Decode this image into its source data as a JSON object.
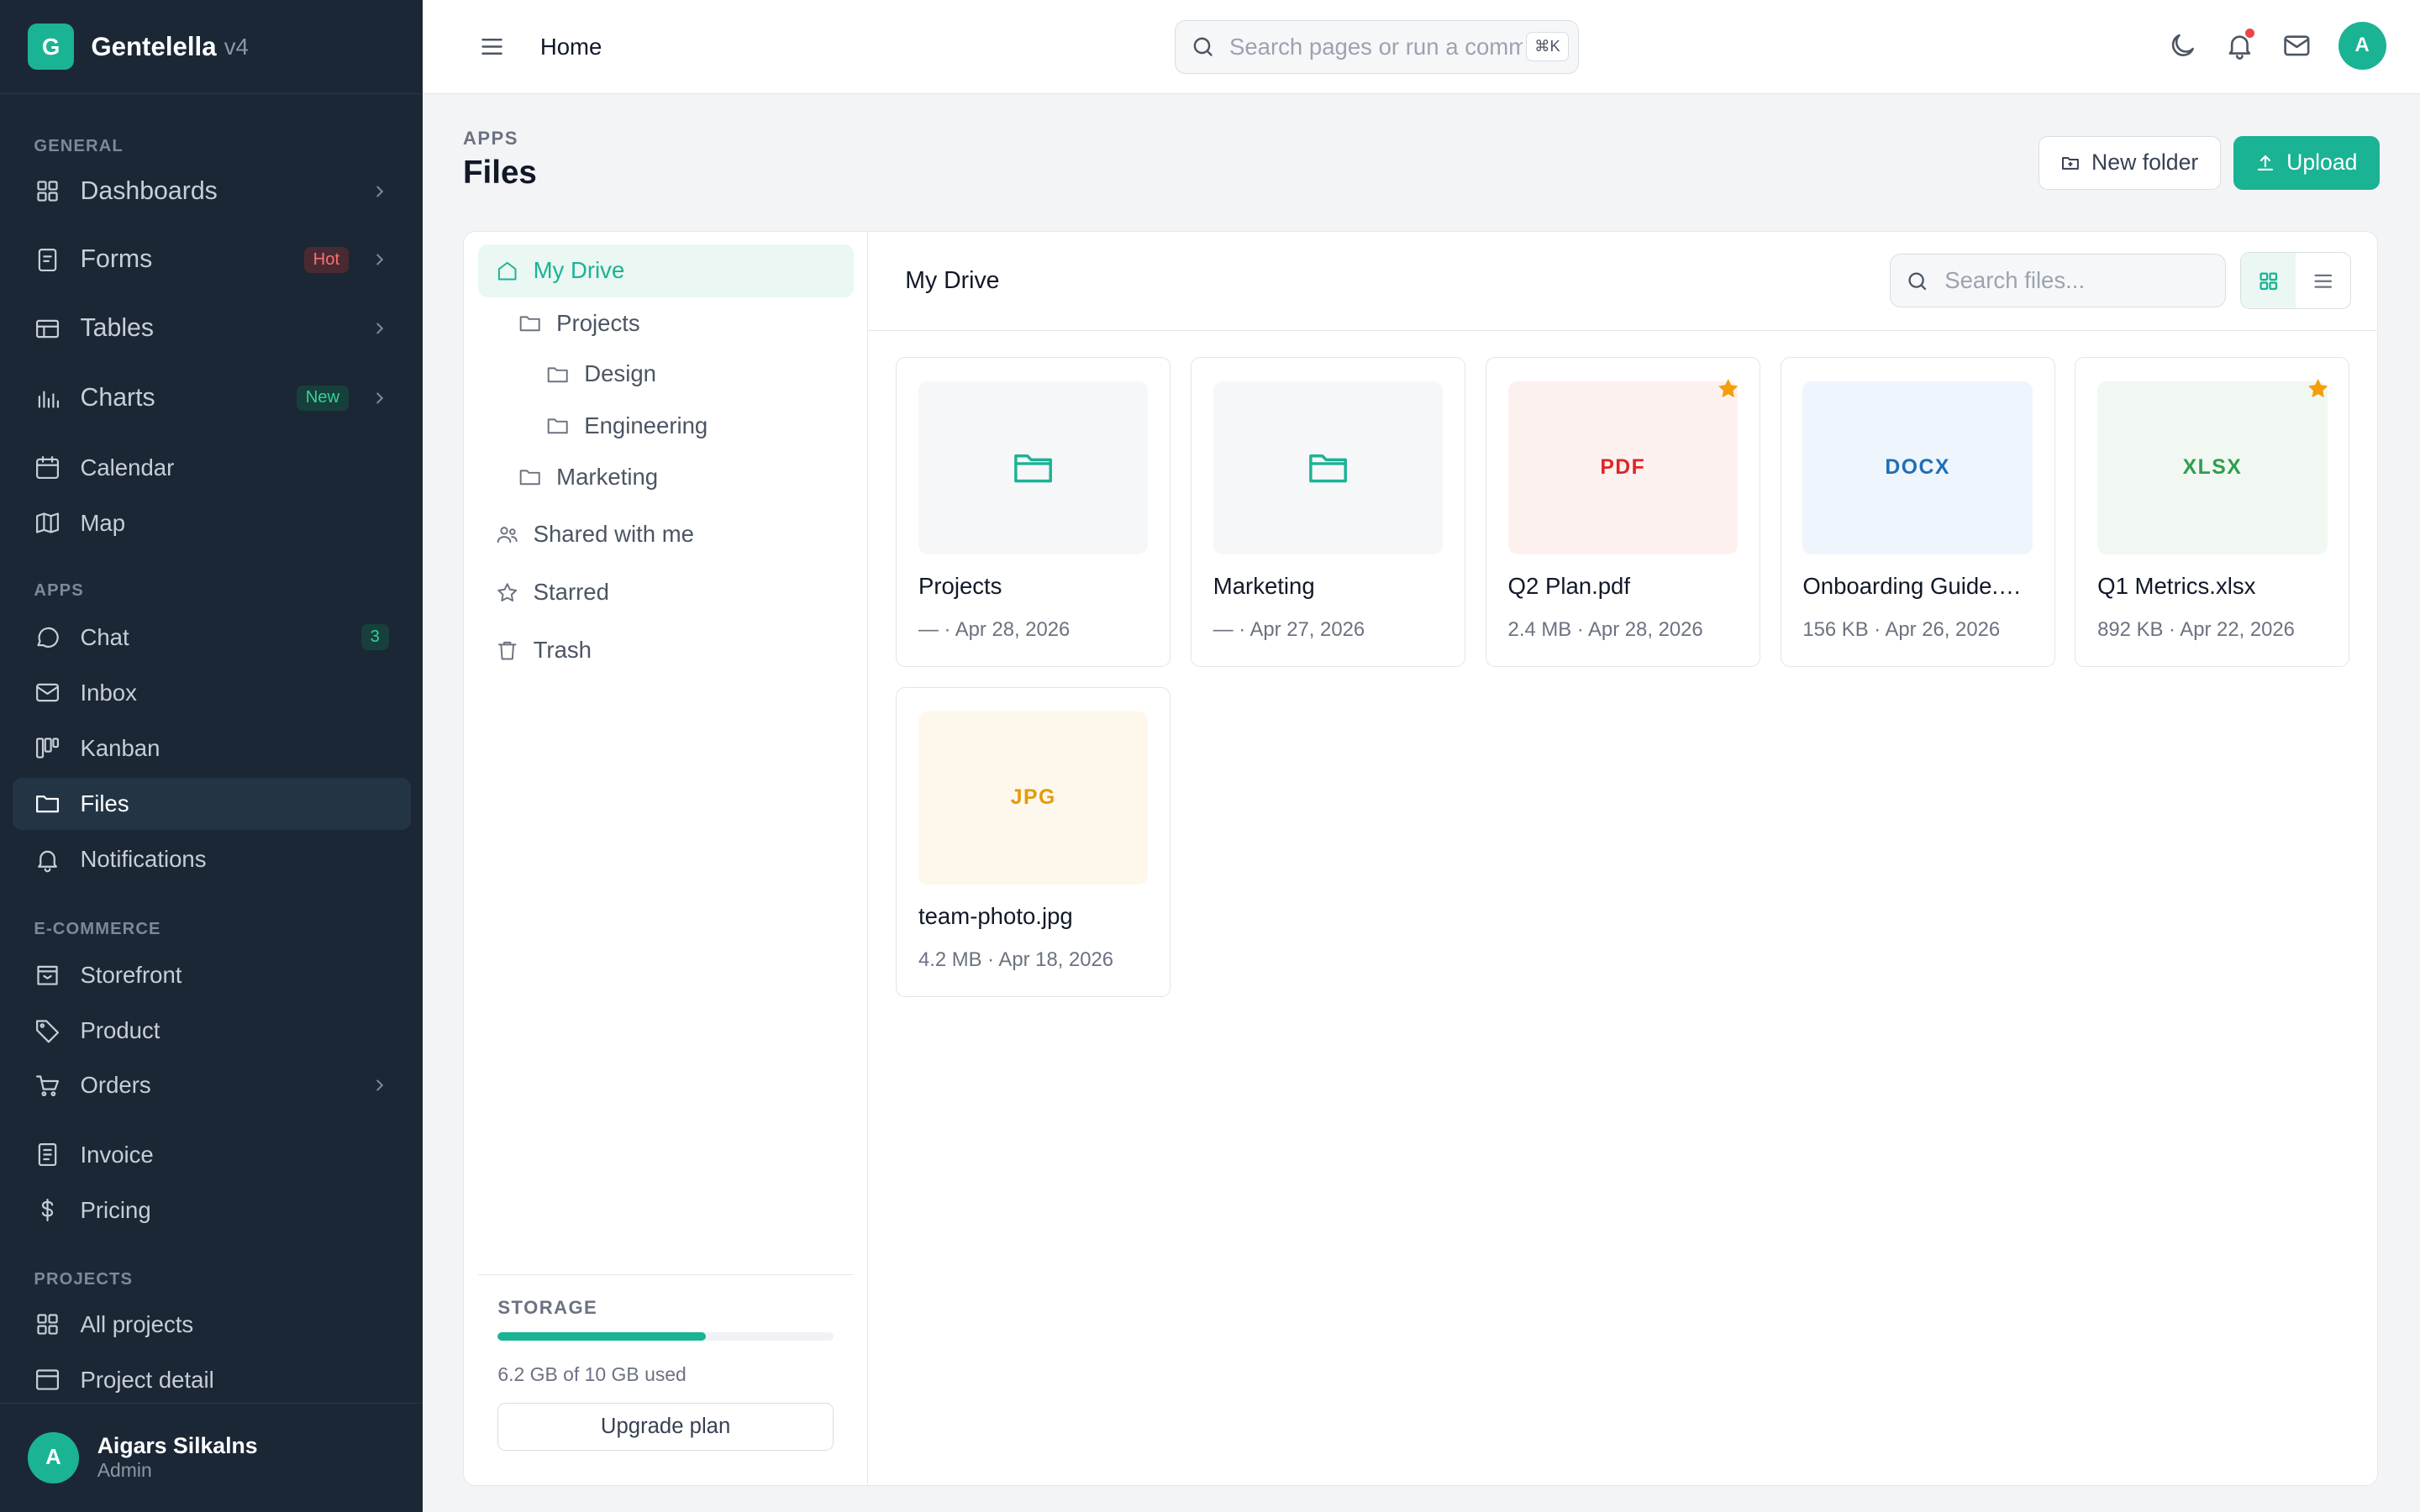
{
  "brand": {
    "logo": "G",
    "name": "Gentelella",
    "version": "v4"
  },
  "sidebar": {
    "sections": [
      {
        "title": "GENERAL",
        "items": [
          {
            "label": "Dashboards",
            "icon": "grid-icon",
            "chevron": true
          },
          {
            "label": "Forms",
            "icon": "form-icon",
            "badge": "Hot",
            "chevron": true
          },
          {
            "label": "Tables",
            "icon": "table-icon",
            "chevron": true
          },
          {
            "label": "Charts",
            "icon": "chart-icon",
            "badge": "New",
            "chevron": true
          },
          {
            "label": "Calendar",
            "icon": "calendar-icon"
          },
          {
            "label": "Map",
            "icon": "map-icon"
          }
        ]
      },
      {
        "title": "APPS",
        "items": [
          {
            "label": "Chat",
            "icon": "chat-icon",
            "count": "3"
          },
          {
            "label": "Inbox",
            "icon": "mail-icon"
          },
          {
            "label": "Kanban",
            "icon": "kanban-icon"
          },
          {
            "label": "Files",
            "icon": "folder-icon",
            "active": true
          },
          {
            "label": "Notifications",
            "icon": "bell-icon"
          }
        ]
      },
      {
        "title": "E-COMMERCE",
        "items": [
          {
            "label": "Storefront",
            "icon": "store-icon"
          },
          {
            "label": "Product",
            "icon": "tag-icon"
          },
          {
            "label": "Orders",
            "icon": "cart-icon",
            "chevron": true
          },
          {
            "label": "Invoice",
            "icon": "invoice-icon"
          },
          {
            "label": "Pricing",
            "icon": "dollar-icon"
          }
        ]
      },
      {
        "title": "PROJECTS",
        "items": [
          {
            "label": "All projects",
            "icon": "grid-icon"
          },
          {
            "label": "Project detail",
            "icon": "window-icon"
          }
        ]
      }
    ],
    "user": {
      "initial": "A",
      "name": "Aigars Silkalns",
      "role": "Admin"
    }
  },
  "topbar": {
    "breadcrumb": "Home",
    "search_placeholder": "Search pages or run a command",
    "shortcut": "⌘K",
    "avatar": "A"
  },
  "page": {
    "overline": "APPS",
    "title": "Files",
    "new_folder_label": "New folder",
    "upload_label": "Upload"
  },
  "tree": {
    "items": [
      {
        "label": "My Drive",
        "icon": "home-icon",
        "level": 0,
        "active": true
      },
      {
        "label": "Projects",
        "icon": "folder-icon",
        "level": 1
      },
      {
        "label": "Design",
        "icon": "folder-icon",
        "level": 2
      },
      {
        "label": "Engineering",
        "icon": "folder-icon",
        "level": 2
      },
      {
        "label": "Marketing",
        "icon": "folder-icon",
        "level": 1
      },
      {
        "label": "Shared with me",
        "icon": "users-icon",
        "level": 0
      },
      {
        "label": "Starred",
        "icon": "star-icon",
        "level": 0
      },
      {
        "label": "Trash",
        "icon": "trash-icon",
        "level": 0
      }
    ],
    "storage": {
      "label": "STORAGE",
      "used_fraction": 0.62,
      "text": "6.2 GB of 10 GB used",
      "upgrade_label": "Upgrade plan"
    }
  },
  "files": {
    "title": "My Drive",
    "search_placeholder": "Search files...",
    "view": "grid",
    "items": [
      {
        "name": "Projects",
        "meta": "— · Apr 28, 2026",
        "kind": "folder",
        "starred": false
      },
      {
        "name": "Marketing",
        "meta": "— · Apr 27, 2026",
        "kind": "folder",
        "starred": false
      },
      {
        "name": "Q2 Plan.pdf",
        "meta": "2.4 MB · Apr 28, 2026",
        "kind": "file",
        "ext": "PDF",
        "starred": true
      },
      {
        "name": "Onboarding Guide.docx",
        "meta": "156 KB · Apr 26, 2026",
        "kind": "file",
        "ext": "DOCX",
        "starred": false
      },
      {
        "name": "Q1 Metrics.xlsx",
        "meta": "892 KB · Apr 22, 2026",
        "kind": "file",
        "ext": "XLSX",
        "starred": true
      },
      {
        "name": "team-photo.jpg",
        "meta": "4.2 MB · Apr 18, 2026",
        "kind": "file",
        "ext": "JPG",
        "starred": false
      }
    ]
  },
  "colors": {
    "accent": "#1ab394",
    "sidebar_bg": "#1b2735",
    "pdf": "#dc2626",
    "pdf_bg": "#fdf1f0",
    "docx": "#1d6fb8",
    "docx_bg": "#eff5fc",
    "xlsx": "#2e9e4f",
    "xlsx_bg": "#f1f8f1",
    "jpg": "#e59a0b",
    "jpg_bg": "#fef8ec",
    "folder_bg": "#f6f7f9"
  }
}
